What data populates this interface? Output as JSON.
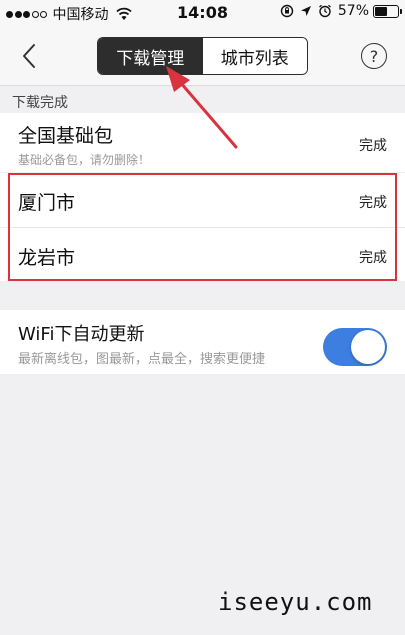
{
  "status_bar": {
    "carrier": "中国移动",
    "time": "14:08",
    "battery": "57%",
    "battery_level": 0.57
  },
  "nav": {
    "tabs": [
      {
        "label": "下载管理",
        "active": true
      },
      {
        "label": "城市列表",
        "active": false
      }
    ],
    "help_label": "?"
  },
  "section": {
    "header": "下载完成",
    "items": [
      {
        "title": "全国基础包",
        "subtitle": "基础必备包，请勿删除！",
        "status": "完成"
      },
      {
        "title": "厦门市",
        "status": "完成"
      },
      {
        "title": "龙岩市",
        "status": "完成"
      }
    ]
  },
  "wifi_setting": {
    "title": "WiFi下自动更新",
    "subtitle": "最新离线包，图最新，点最全，搜索更便捷",
    "enabled": true
  },
  "watermark": "iseeyu.com",
  "colors": {
    "accent": "#3d7fe0",
    "highlight": "#d9333f",
    "segment_active": "#2d2d2d"
  }
}
